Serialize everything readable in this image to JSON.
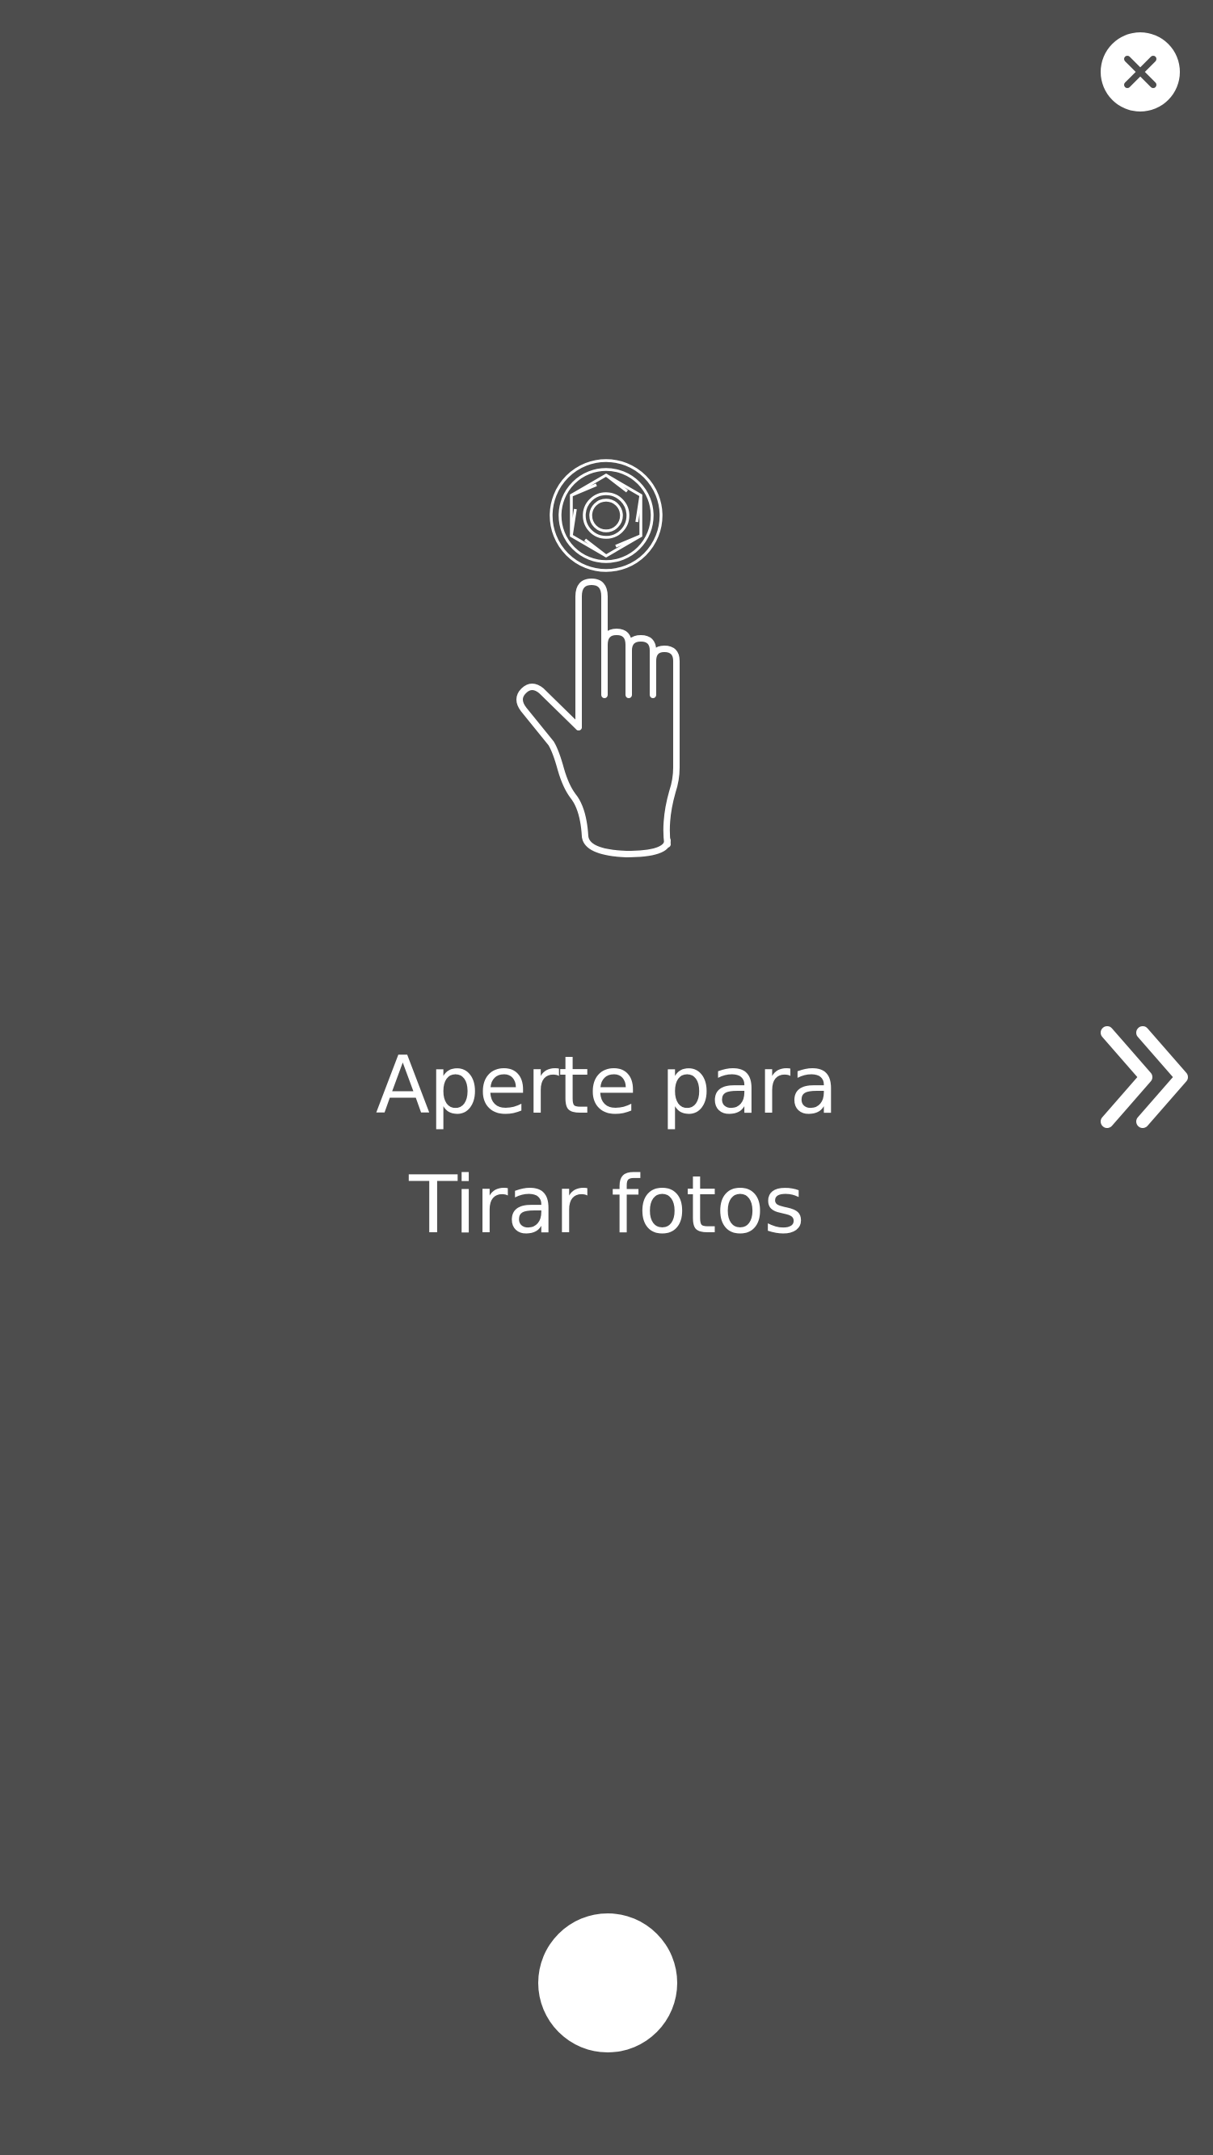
{
  "colors": {
    "background": "#4d4d4d",
    "foreground": "#ffffff"
  },
  "controls": {
    "close_icon": "close-icon",
    "next_icon": "double-chevron-right-icon",
    "shutter": "shutter-button"
  },
  "illustration": {
    "icon": "tap-camera-icon"
  },
  "instruction": {
    "line1": "Aperte para",
    "line2": "Tirar fotos"
  }
}
